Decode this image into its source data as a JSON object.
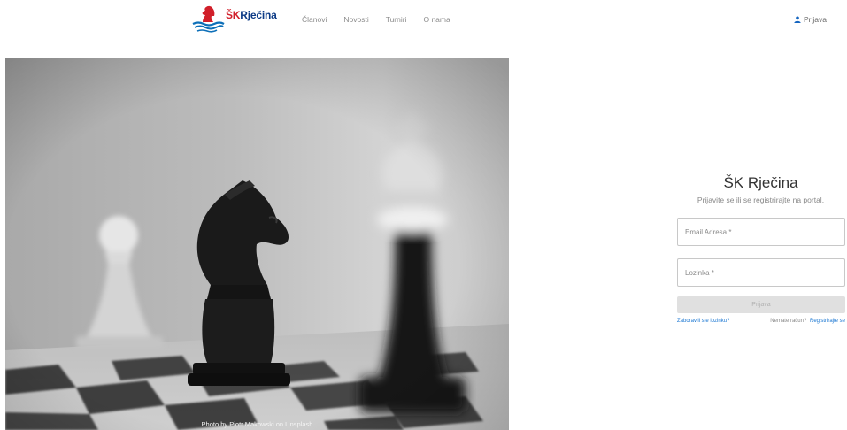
{
  "brand": {
    "name_prefix": "ŠK",
    "name_main": "Rječina",
    "logo_icon": "knight-wave-logo",
    "colors": {
      "primary": "#0d3b86",
      "accent": "#d11f2a"
    }
  },
  "nav": {
    "items": [
      {
        "label": "Članovi"
      },
      {
        "label": "Novosti"
      },
      {
        "label": "Turniri"
      },
      {
        "label": "O nama"
      }
    ],
    "login": {
      "label": "Prijava",
      "icon": "user-icon"
    }
  },
  "hero": {
    "credit": "Photo by Piotr Makowski on Unsplash"
  },
  "login_panel": {
    "title": "ŠK Rječina",
    "subtitle": "Prijavite se ili se registrirajte na portal.",
    "email_placeholder": "Email Adresa *",
    "password_placeholder": "Lozinka *",
    "submit_label": "Prijava",
    "forgot_label": "Zaboravili ste lozinku?",
    "no_account_label": "Nemate račun?",
    "register_label": "Registrirajte se",
    "link_color": "#1976d2"
  }
}
